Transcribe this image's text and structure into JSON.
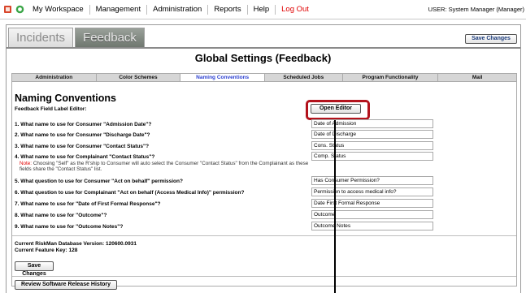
{
  "nav": {
    "items": [
      "My Workspace",
      "Management",
      "Administration",
      "Reports",
      "Help"
    ],
    "logout": "Log Out",
    "user": "USER: System Manager (Manager)"
  },
  "module_tabs": [
    {
      "label": "Incidents",
      "active": false
    },
    {
      "label": "Feedback",
      "active": true
    }
  ],
  "save_changes_top": "Save Changes",
  "page_title": "Global Settings (Feedback)",
  "settings_tabs": [
    {
      "label": "Administration",
      "active": false
    },
    {
      "label": "Color Schemes",
      "active": false
    },
    {
      "label": "Naming Conventions",
      "active": true
    },
    {
      "label": "Scheduled Jobs",
      "active": false
    },
    {
      "label": "Program Functionality",
      "active": false
    },
    {
      "label": "Mail",
      "active": false
    }
  ],
  "section": {
    "title": "Naming Conventions",
    "subtitle": "Feedback Field Label Editor:",
    "open_editor": "Open Editor"
  },
  "questions": [
    {
      "q": "1. What name to use for Consumer \"Admission Date\"?",
      "value": "Date of Admission"
    },
    {
      "q": "2. What name to use for Consumer \"Discharge Date\"?",
      "value": "Date of Discharge"
    },
    {
      "q": "3. What name to use for Consumer \"Contact Status\"?",
      "value": "Cons. Status"
    },
    {
      "q": "4. What name to use for Complainant \"Contact Status\"?",
      "value": "Comp. Status"
    },
    {
      "q": "5. What question to use for Consumer \"Act on behalf\" permission?",
      "value": "Has Consumer Permission?"
    },
    {
      "q": "6. What question to use for Complainant \"Act on behalf (Access Medical Info)\" permission?",
      "value": "Permission to access medical info?"
    },
    {
      "q": "7. What name to use for \"Date of First Formal Response\"?",
      "value": "Date First Formal Response"
    },
    {
      "q": "8. What name to use for \"Outcome\"?",
      "value": "Outcome"
    },
    {
      "q": "9. What name to use for \"Outcome Notes\"?",
      "value": "Outcome Notes"
    }
  ],
  "note": {
    "label": "Note:",
    "text": "Choosing \"Self\" as the R'ship to Consumer will auto select the Consumer \"Contact Status\" from the Complainant as these fields share the \"Contact Status\" list."
  },
  "version": {
    "db": "Current RiskMan Database Version: 120600.0931",
    "feature": "Current Feature Key: 128"
  },
  "save_changes_bottom": "Save Changes",
  "review_history": "Review Software Release History",
  "colors": {
    "logout": "#e00000",
    "active_subtab": "#2b3fd1",
    "highlight": "#b3121c"
  }
}
